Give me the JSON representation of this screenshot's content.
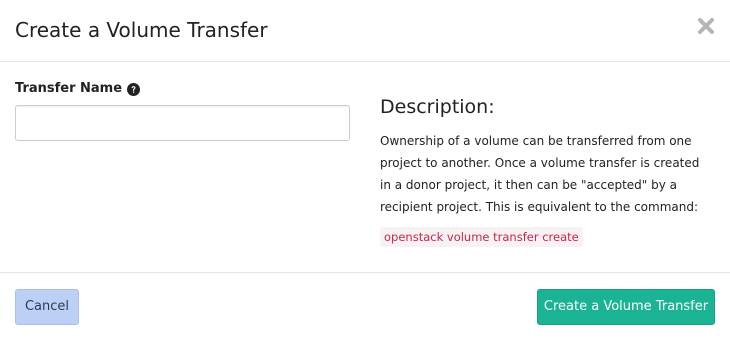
{
  "dialog": {
    "title": "Create a Volume Transfer",
    "close_icon": "close-icon"
  },
  "form": {
    "transfer_name_label": "Transfer Name",
    "help_icon": "question-circle-icon",
    "transfer_name_value": "",
    "transfer_name_placeholder": ""
  },
  "description": {
    "heading": "Description:",
    "text": "Ownership of a volume can be transferred from one project to another. Once a volume transfer is created in a donor project, it then can be \"accepted\" by a recipient project. This is equivalent to the command:",
    "command": "openstack volume transfer create"
  },
  "footer": {
    "cancel_label": "Cancel",
    "submit_label": "Create a Volume Transfer"
  },
  "colors": {
    "primary_button": "#1ab394",
    "cancel_button": "#bcd0f5",
    "command_text": "#c7254e",
    "command_background": "#f9f2f4"
  }
}
